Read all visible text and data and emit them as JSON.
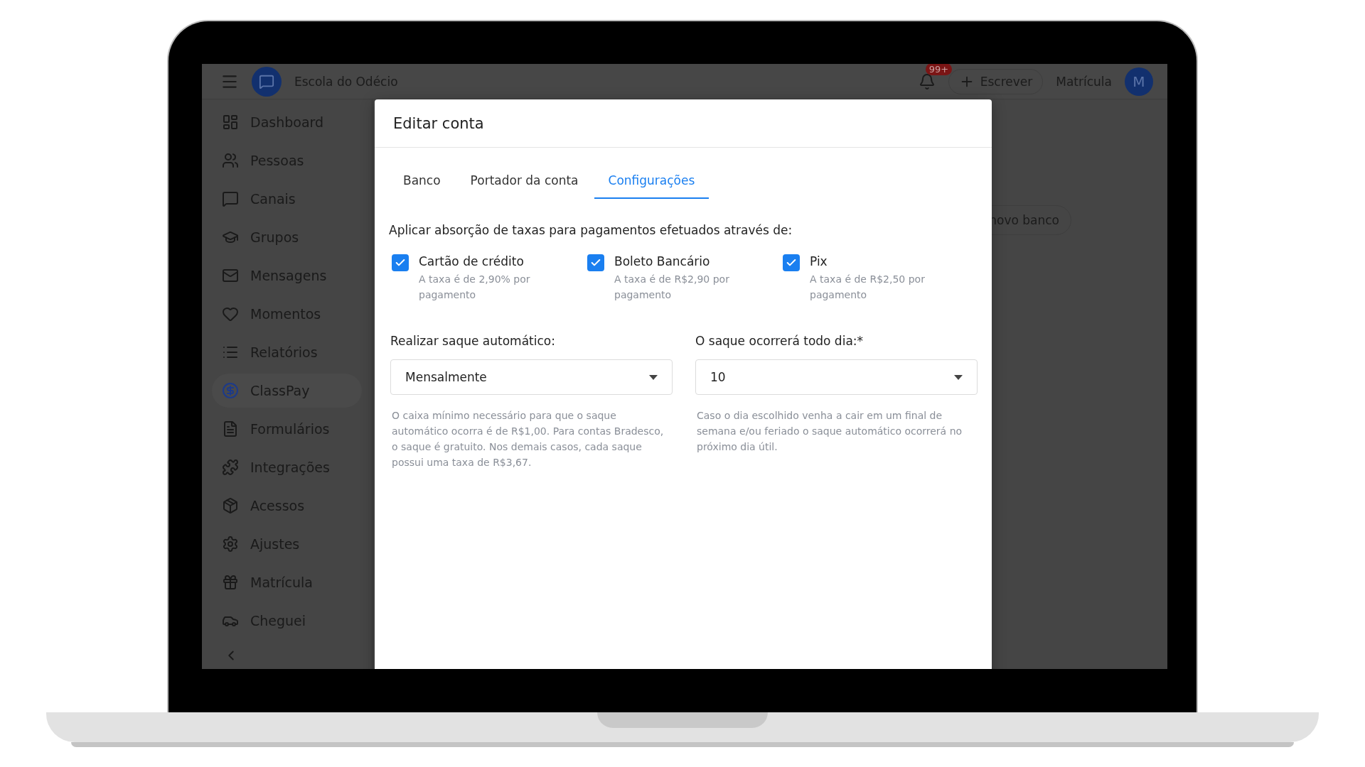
{
  "topbar": {
    "school": "Escola do Odécio",
    "notifications": "99+",
    "compose": "Escrever",
    "enroll": "Matrícula",
    "avatar": "M"
  },
  "sidebar": {
    "items": [
      {
        "label": "Dashboard",
        "selected": false
      },
      {
        "label": "Pessoas",
        "selected": false
      },
      {
        "label": "Canais",
        "selected": false
      },
      {
        "label": "Grupos",
        "selected": false
      },
      {
        "label": "Mensagens",
        "selected": false
      },
      {
        "label": "Momentos",
        "selected": false
      },
      {
        "label": "Relatórios",
        "selected": false
      },
      {
        "label": "ClassPay",
        "selected": true
      },
      {
        "label": "Formulários",
        "selected": false
      },
      {
        "label": "Integrações",
        "selected": false
      },
      {
        "label": "Acessos",
        "selected": false
      },
      {
        "label": "Ajustes",
        "selected": false
      },
      {
        "label": "Matrícula",
        "selected": false
      },
      {
        "label": "Cheguei",
        "selected": false
      }
    ]
  },
  "background": {
    "button": "novo banco"
  },
  "modal": {
    "title": "Editar conta",
    "tabs": [
      {
        "label": "Banco",
        "selected": false
      },
      {
        "label": "Portador da conta",
        "selected": false
      },
      {
        "label": "Configurações",
        "selected": true
      }
    ],
    "section_title": "Aplicar absorção de taxas para pagamentos efetuados através de:",
    "options": [
      {
        "label": "Cartão de crédito",
        "note": "A taxa é de 2,90% por pagamento",
        "checked": true
      },
      {
        "label": "Boleto Bancário",
        "note": "A taxa é de R$2,90 por pagamento",
        "checked": true
      },
      {
        "label": "Pix",
        "note": "A taxa é de R$2,50 por pagamento",
        "checked": true
      }
    ],
    "fields": [
      {
        "label": "Realizar saque automático:",
        "value": "Mensalmente",
        "help": "O caixa mínimo necessário para que o saque automático ocorra é de R$1,00. Para contas Bradesco, o saque é gratuito. Nos demais casos, cada saque possui uma taxa de R$3,67."
      },
      {
        "label": "O saque ocorrerá todo dia:*",
        "value": "10",
        "help": "Caso o dia escolhido venha a cair em um final de semana e/ou feriado o saque automático ocorrerá no próximo dia útil."
      }
    ]
  }
}
